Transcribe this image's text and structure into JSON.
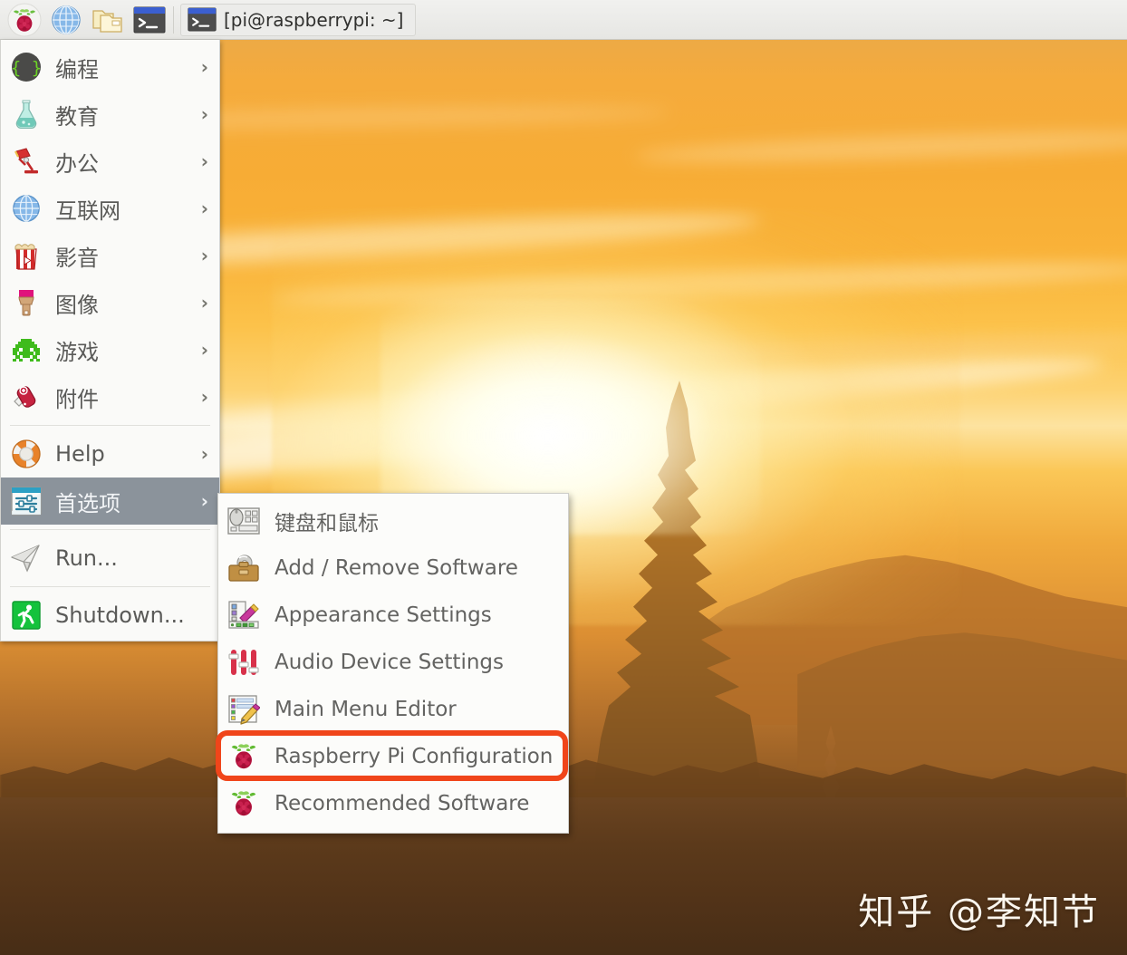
{
  "taskbar": {
    "launchers": [
      {
        "name": "raspberry-menu-icon",
        "label": "Raspberry Pi Menu"
      },
      {
        "name": "web-browser-icon",
        "label": "Web Browser"
      },
      {
        "name": "file-manager-icon",
        "label": "File Manager"
      },
      {
        "name": "terminal-icon",
        "label": "Terminal"
      }
    ],
    "window_button": {
      "icon": "terminal-icon",
      "title": "[pi@raspberrypi: ~]"
    }
  },
  "menu": {
    "items": [
      {
        "label": "编程",
        "icon": "programming-icon",
        "arrow": "›",
        "selected": false
      },
      {
        "label": "教育",
        "icon": "education-icon",
        "arrow": "›",
        "selected": false
      },
      {
        "label": "办公",
        "icon": "office-icon",
        "arrow": "›",
        "selected": false
      },
      {
        "label": "互联网",
        "icon": "internet-icon",
        "arrow": "›",
        "selected": false
      },
      {
        "label": "影音",
        "icon": "media-icon",
        "arrow": "›",
        "selected": false
      },
      {
        "label": "图像",
        "icon": "graphics-icon",
        "arrow": "›",
        "selected": false
      },
      {
        "label": "游戏",
        "icon": "games-icon",
        "arrow": "›",
        "selected": false
      },
      {
        "label": "附件",
        "icon": "accessories-icon",
        "arrow": "›",
        "selected": false
      },
      {
        "label": "Help",
        "icon": "help-icon",
        "arrow": "›",
        "selected": false
      },
      {
        "label": "首选项",
        "icon": "preferences-icon",
        "arrow": "›",
        "selected": true
      },
      {
        "label": "Run...",
        "icon": "run-icon",
        "arrow": "",
        "selected": false
      },
      {
        "label": "Shutdown...",
        "icon": "shutdown-icon",
        "arrow": "",
        "selected": false
      }
    ]
  },
  "submenu": {
    "parent": "首选项",
    "items": [
      {
        "label": "键盘和鼠标",
        "icon": "keyboard-mouse-icon",
        "highlighted": false
      },
      {
        "label": "Add / Remove Software",
        "icon": "add-remove-software-icon",
        "highlighted": false
      },
      {
        "label": "Appearance Settings",
        "icon": "appearance-settings-icon",
        "highlighted": false
      },
      {
        "label": "Audio Device Settings",
        "icon": "audio-device-icon",
        "highlighted": false
      },
      {
        "label": "Main Menu Editor",
        "icon": "main-menu-editor-icon",
        "highlighted": false
      },
      {
        "label": "Raspberry Pi Configuration",
        "icon": "raspberry-icon",
        "highlighted": true
      },
      {
        "label": "Recommended Software",
        "icon": "raspberry-icon",
        "highlighted": false
      }
    ]
  },
  "annotation": {
    "highlight_color": "#f0451a",
    "target_label": "Raspberry Pi Configuration"
  },
  "watermark": {
    "text": "知乎 @李知节"
  },
  "colors": {
    "selected_row": "#8b939b",
    "menu_bg": "#fafaf8",
    "taskbar_bg": "#eeeeec",
    "text": "#5a5a58"
  }
}
